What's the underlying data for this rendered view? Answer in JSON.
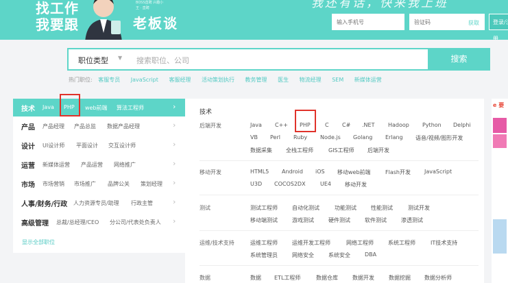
{
  "banner": {
    "line1": "找工作",
    "line2": "我要跟",
    "line3": "老板谈",
    "boss_tag": "BOSS直聘 兴趣小王 · 直聘",
    "script_text": "我还有话，快来我上班",
    "phone_placeholder": "输入手机号",
    "code_placeholder": "验证码",
    "get_code": "获取",
    "login": "登录/注册",
    "color": "#5dd5c8"
  },
  "search": {
    "job_type": "职位类型",
    "placeholder": "搜索职位、公司",
    "button": "搜索"
  },
  "hot": {
    "label": "热门职位:",
    "items": [
      "客服专员",
      "JavaScript",
      "客服经理",
      "活动策划执行",
      "教务管理",
      "医生",
      "物流经理",
      "SEM",
      "新媒体运营"
    ]
  },
  "menu": {
    "rows": [
      {
        "cat": "技术",
        "subs": [
          "Java",
          "PHP",
          "web前端",
          "算法工程师"
        ]
      },
      {
        "cat": "产品",
        "subs": [
          "产品经理",
          "产品总监",
          "数据产品经理"
        ]
      },
      {
        "cat": "设计",
        "subs": [
          "UI设计师",
          "平面设计",
          "交互设计师"
        ]
      },
      {
        "cat": "运营",
        "subs": [
          "新媒体运营",
          "产品运营",
          "网络推广"
        ]
      },
      {
        "cat": "市场",
        "subs": [
          "市场营销",
          "市场推广",
          "品牌公关",
          "策划经理"
        ]
      },
      {
        "cat": "人事/财务/行政",
        "subs": [
          "人力资源专员/助理",
          "行政主管"
        ]
      },
      {
        "cat": "高级管理",
        "subs": [
          "总裁/总经理/CEO",
          "分公司/代表处负责人"
        ]
      }
    ],
    "show_all": "显示全部职位"
  },
  "panel": {
    "title": "技术",
    "groups": [
      {
        "label": "后端开发",
        "lines": [
          [
            "Java",
            "C++",
            "PHP",
            "C",
            "C#",
            ".NET",
            "Hadoop",
            "Python",
            "Delphi"
          ],
          [
            "VB",
            "Perl",
            "Ruby",
            "Node.js",
            "Golang",
            "Erlang",
            "语音/视频/图形开发"
          ],
          [
            "数据采集",
            "全栈工程师",
            "GIS工程师",
            "后端开发"
          ]
        ]
      },
      {
        "label": "移动开发",
        "lines": [
          [
            "HTML5",
            "Android",
            "iOS",
            "移动web前端",
            "Flash开发",
            "JavaScript"
          ],
          [
            "U3D",
            "COCOS2DX",
            "UE4",
            "移动开发"
          ]
        ]
      },
      {
        "label": "测试",
        "lines": [
          [
            "测试工程师",
            "自动化测试",
            "功能测试",
            "性能测试",
            "测试开发"
          ],
          [
            "移动端测试",
            "游戏测试",
            "硬件测试",
            "软件测试",
            "渗透测试"
          ]
        ]
      },
      {
        "label": "运维/技术支持",
        "lines": [
          [
            "运维工程师",
            "运维开发工程师",
            "网络工程师",
            "系统工程师",
            "IT技术支持"
          ],
          [
            "系统管理员",
            "网络安全",
            "系统安全",
            "DBA"
          ]
        ]
      },
      {
        "label": "数据",
        "lines": [
          [
            "数据",
            "ETL工程师",
            "数据仓库",
            "数据开发",
            "数据挖掘",
            "数据分析师"
          ]
        ]
      }
    ]
  },
  "side_ad": {
    "text": "e 要"
  }
}
